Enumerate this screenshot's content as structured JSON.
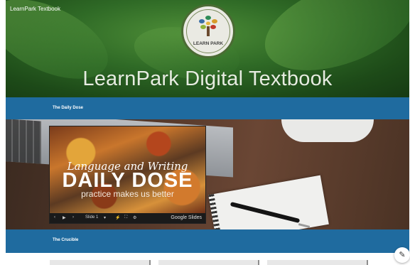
{
  "site": {
    "name": "LearnPark Textbook"
  },
  "hero": {
    "title": "LearnPark Digital Textbook",
    "logo_text": "LEARN PARK"
  },
  "sections": [
    {
      "title": "The Daily Dose"
    },
    {
      "title": "The Crucible"
    }
  ],
  "slides": {
    "line1": "Language and Writing",
    "line2": "DAILY DOSE",
    "line3": "practice makes us better",
    "slide_label": "Slide 1",
    "brand": "Google Slides",
    "icons": [
      "prev-icon",
      "play-icon",
      "next-icon",
      "link-icon",
      "fullscreen-icon",
      "settings-icon"
    ]
  },
  "colors": {
    "section_bar": "#1f6b9f",
    "hero_green": "#2f6a26"
  },
  "edit": {
    "icon": "pencil-icon"
  }
}
